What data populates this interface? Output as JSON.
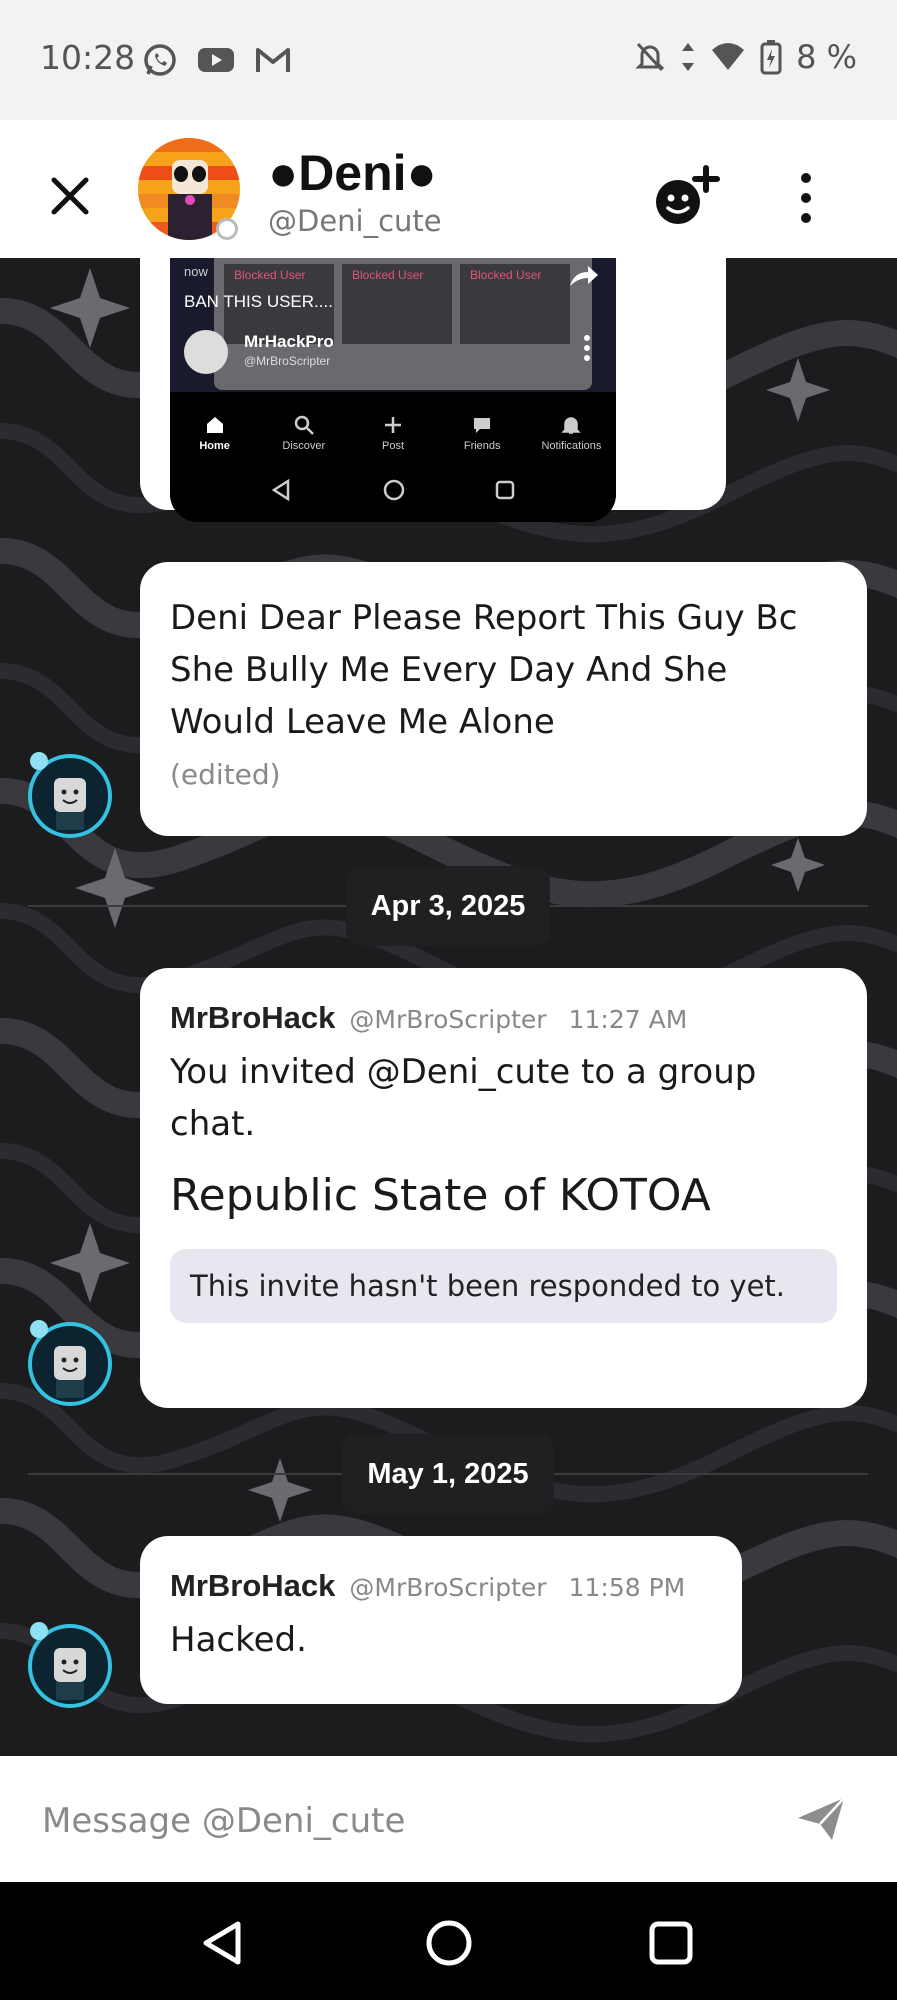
{
  "status_bar": {
    "time": "10:28",
    "battery": "8 %"
  },
  "header": {
    "name": "●Deni●",
    "username": "@Deni_cute"
  },
  "shared_screenshot": {
    "timestamp": "now",
    "blocked_labels": [
      "Blocked User",
      "Blocked User",
      "Blocked User"
    ],
    "caption": "BAN THIS USER....",
    "user_name": "MrHackPro",
    "user_handle": "@MrBroScripter",
    "nav": [
      "Home",
      "Discover",
      "Post",
      "Friends",
      "Notifications"
    ]
  },
  "messages": [
    {
      "text": "Deni Dear Please Report This Guy Bc She Bully Me Every Day And She Would Leave Me Alone",
      "edited": "(edited)"
    },
    {
      "author": "MrBroHack",
      "handle": "@MrBroScripter",
      "time": "11:27 AM",
      "text": "You invited @Deni_cute to a group chat.",
      "group_name": "Republic State of KOTOA",
      "invite_status": "This invite hasn't been responded to yet."
    },
    {
      "author": "MrBroHack",
      "handle": "@MrBroScripter",
      "time": "11:58 PM",
      "text": "Hacked."
    }
  ],
  "dates": [
    "Apr 3, 2025",
    "May 1, 2025"
  ],
  "composer": {
    "placeholder": "Message @Deni_cute"
  },
  "colors": {
    "accent_ring": "#35c2e0",
    "bubble": "#ffffff",
    "chat_bg": "#1c1b1e",
    "invite_box": "#e7e7f0"
  }
}
